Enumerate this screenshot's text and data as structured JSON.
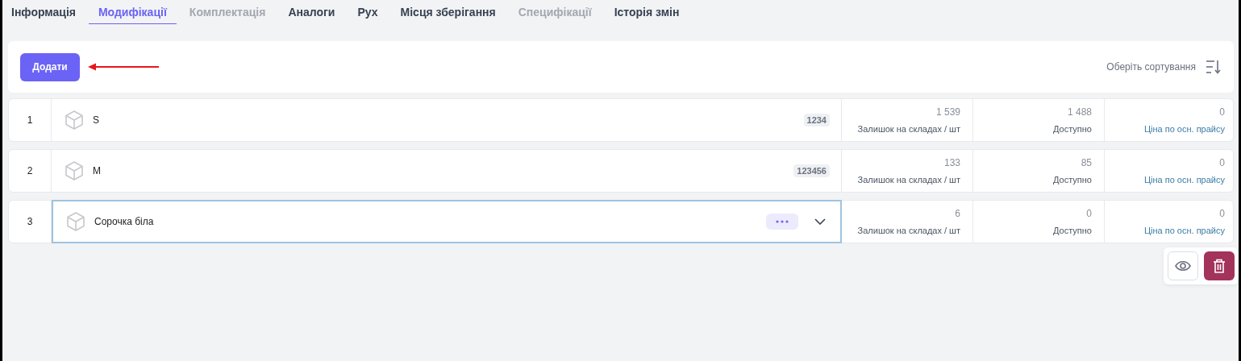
{
  "tabs": [
    {
      "label": "Інформація",
      "selected": false,
      "disabled": false
    },
    {
      "label": "Модифікації",
      "selected": true,
      "disabled": false
    },
    {
      "label": "Комплектація",
      "selected": false,
      "disabled": true
    },
    {
      "label": "Аналоги",
      "selected": false,
      "disabled": false
    },
    {
      "label": "Рух",
      "selected": false,
      "disabled": false
    },
    {
      "label": "Місця зберігання",
      "selected": false,
      "disabled": false
    },
    {
      "label": "Специфікації",
      "selected": false,
      "disabled": true
    },
    {
      "label": "Історія змін",
      "selected": false,
      "disabled": false
    }
  ],
  "toolbar": {
    "add_button": "Додати",
    "sort_label": "Оберіть сортування"
  },
  "rows": [
    {
      "number": "1",
      "name": "S",
      "code": "1234",
      "selected": false,
      "stock": "1 539",
      "stock_label": "Залишок на складах / шт",
      "available": "1 488",
      "available_label": "Доступно",
      "price": "0",
      "price_label": "Ціна по осн. прайсу"
    },
    {
      "number": "2",
      "name": "M",
      "code": "123456",
      "selected": false,
      "stock": "133",
      "stock_label": "Залишок на складах / шт",
      "available": "85",
      "available_label": "Доступно",
      "price": "0",
      "price_label": "Ціна по осн. прайсу"
    },
    {
      "number": "3",
      "name": "Сорочка біла",
      "selected": true,
      "stock": "6",
      "stock_label": "Залишок на складах / шт",
      "available": "0",
      "available_label": "Доступно",
      "price": "0",
      "price_label": "Ціна по осн. прайсу"
    }
  ],
  "row_actions": [
    {
      "kind": "view"
    },
    {
      "kind": "delete"
    }
  ]
}
